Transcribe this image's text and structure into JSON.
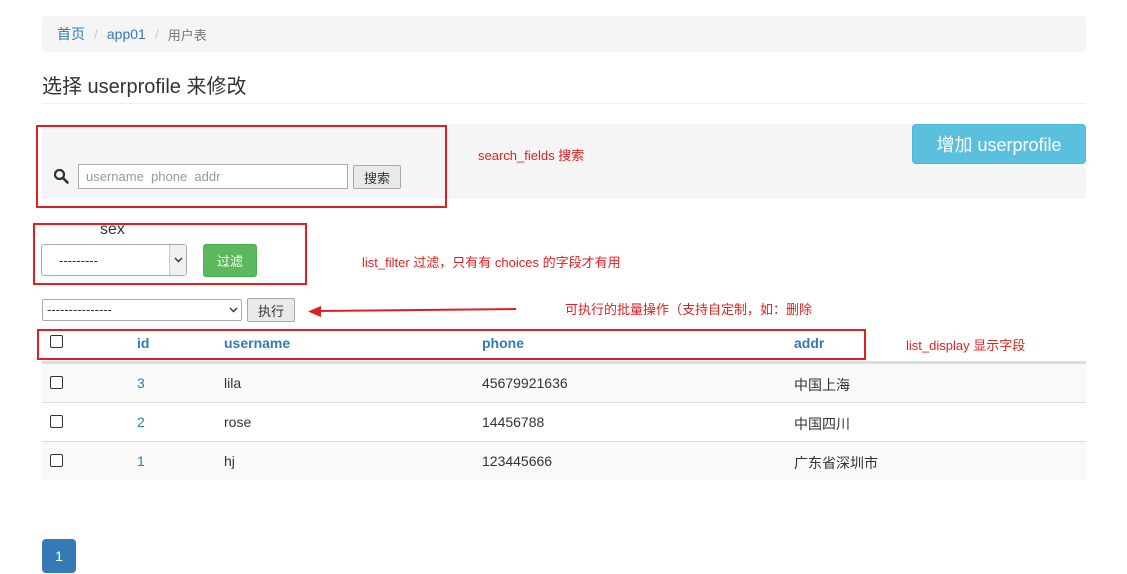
{
  "breadcrumb": {
    "home": "首页",
    "app": "app01",
    "current": "用户表",
    "separator": "/"
  },
  "page_title": "选择 userprofile 来修改",
  "search": {
    "placeholder": "username  phone  addr",
    "button": "搜索"
  },
  "add_button": "增加 userprofile",
  "filter": {
    "label": "sex",
    "selected": "---------",
    "button": "过滤"
  },
  "actions": {
    "selected": "---------------",
    "button": "执行"
  },
  "table": {
    "headers": [
      "id",
      "username",
      "phone",
      "addr"
    ],
    "rows": [
      {
        "id": "3",
        "username": "lila",
        "phone": "45679921636",
        "addr": "中国上海"
      },
      {
        "id": "2",
        "username": "rose",
        "phone": "14456788",
        "addr": "中国四川"
      },
      {
        "id": "1",
        "username": "hj",
        "phone": "123445666",
        "addr": "广东省深圳市"
      }
    ]
  },
  "pagination": {
    "current": "1"
  },
  "annotations": {
    "search_fields": "search_fields 搜索",
    "list_filter": "list_filter 过滤，只有有 choices 的字段才有用",
    "actions": "可执行的批量操作（支持自定制，如：删除",
    "list_display": "list_display 显示字段"
  },
  "colors": {
    "primary": "#337ab7",
    "info": "#5bc0de",
    "success": "#5cb85c",
    "annotation": "#e02020"
  },
  "icons": {
    "search": "search-icon",
    "dropdown": "chevron-down-icon",
    "annotation_arrow": "arrow-left-icon"
  }
}
